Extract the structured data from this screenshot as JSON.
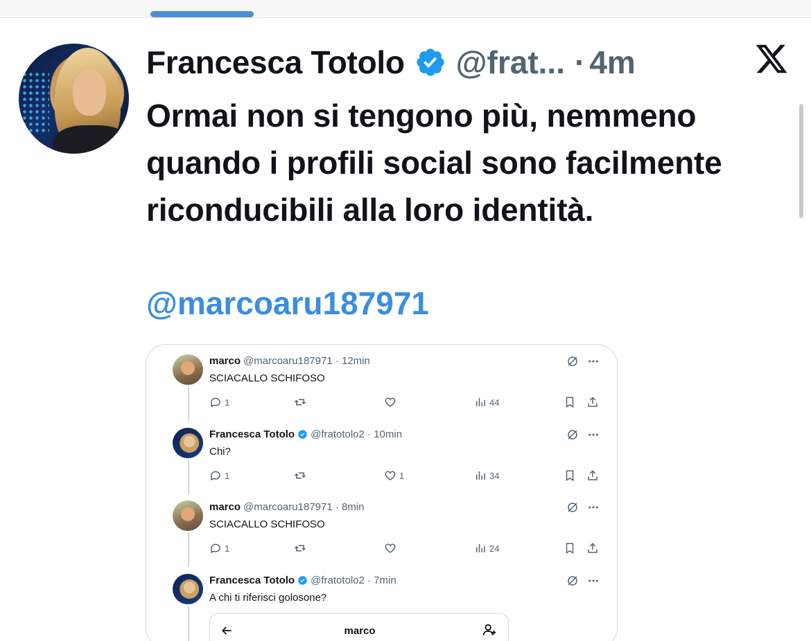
{
  "tweet": {
    "author_name": "Francesca Totolo",
    "handle": "@frat...",
    "separator": "·",
    "time": "4m",
    "text": "Ormai non si tengono più, nemmeno quando i profili social sono facilmente riconducibili alla loro identità.",
    "mention": "@marcoaru187971",
    "avatar_icon": "profile-photo"
  },
  "colors": {
    "link": "#3a8ee0",
    "verified": "#1d9bf0",
    "secondary_text": "#536471",
    "top_indicator": "#4a90d9"
  },
  "embedded_thread": [
    {
      "name": "marco",
      "handle": "@marcoaru187971 · 12min",
      "verified": false,
      "text": "SCIACALLO SCHIFOSO",
      "replies": "1",
      "retweets": "",
      "likes": "",
      "views": "44"
    },
    {
      "name": "Francesca Totolo",
      "handle": "@fratotolo2 · 10min",
      "verified": true,
      "text": "Chi?",
      "replies": "1",
      "retweets": "",
      "likes": "1",
      "views": "34"
    },
    {
      "name": "marco",
      "handle": "@marcoaru187971 · 8min",
      "verified": false,
      "text": "SCIACALLO SCHIFOSO",
      "replies": "1",
      "retweets": "",
      "likes": "",
      "views": "24"
    },
    {
      "name": "Francesca Totolo",
      "handle": "@fratotolo2 · 7min",
      "verified": true,
      "text": "A chi ti riferisci golosone?"
    }
  ],
  "profile_card": {
    "title": "marco"
  }
}
